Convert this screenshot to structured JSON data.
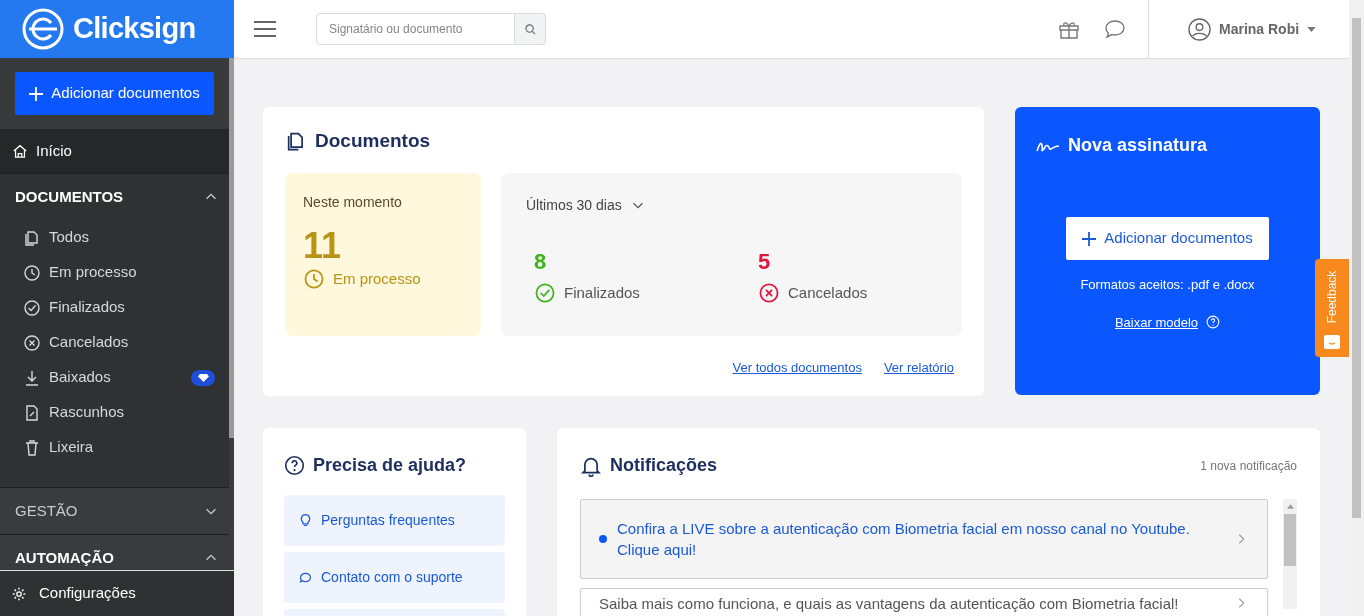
{
  "brand": "Clicksign",
  "sidebar": {
    "add_button": "Adicionar documentos",
    "home": {
      "label": "Início",
      "selected": true
    },
    "sections": [
      {
        "title": "DOCUMENTOS",
        "expanded": true,
        "items": [
          {
            "label": "Todos",
            "premium": false
          },
          {
            "label": "Em processo",
            "premium": false
          },
          {
            "label": "Finalizados",
            "premium": false
          },
          {
            "label": "Cancelados",
            "premium": false
          },
          {
            "label": "Baixados",
            "premium": true
          },
          {
            "label": "Rascunhos",
            "premium": false
          },
          {
            "label": "Lixeira",
            "premium": false
          }
        ]
      },
      {
        "title": "GESTÃO",
        "expanded": false
      },
      {
        "title": "AUTOMAÇÃO",
        "expanded": true
      }
    ],
    "footer": "Configurações"
  },
  "header": {
    "search": {
      "placeholder": "Signatário ou documento"
    },
    "user": "Marina Robi"
  },
  "documents": {
    "title": "Documentos",
    "now": {
      "label": "Neste momento",
      "count": "11",
      "status": "Em processo"
    },
    "period": "Últimos 30 dias",
    "stats": [
      {
        "kind": "done",
        "count": "8",
        "label": "Finalizados"
      },
      {
        "kind": "cancel",
        "count": "5",
        "label": "Cancelados"
      }
    ],
    "links": [
      "Ver todos documentos",
      "Ver relatório"
    ]
  },
  "new_signature": {
    "title": "Nova assinatura",
    "button": "Adicionar documentos",
    "formats": "Formatos aceitos: .pdf e .docx",
    "link": "Baixar modelo"
  },
  "help": {
    "title": "Precisa de ajuda?",
    "items": [
      {
        "label": "Perguntas frequentes"
      },
      {
        "label": "Contato com o suporte"
      }
    ]
  },
  "notifications": {
    "title": "Notificações",
    "count": "1 nova notificação",
    "items": [
      {
        "text": "Confira a LIVE sobre a autenticação com Biometria facial em nosso canal no Youtube. Clique aqui!",
        "unread": true
      },
      {
        "text": "Saiba mais como funciona, e quais as vantagens da autenticação com Biometria facial!",
        "unread": false
      }
    ]
  },
  "feedback": "Feedback"
}
